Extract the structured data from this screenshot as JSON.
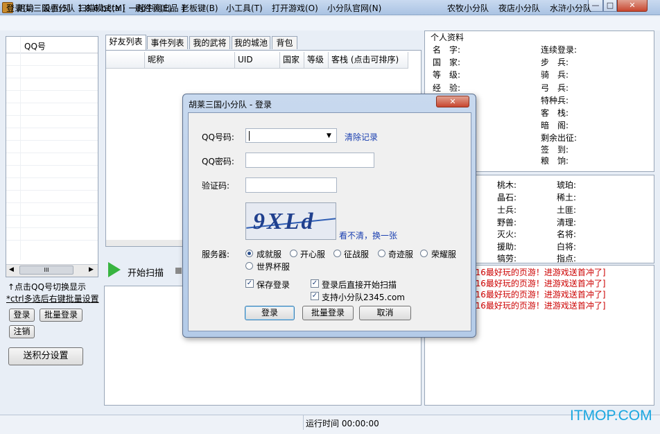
{
  "window": {
    "title": "胡莱三国小分队 1.8.6 beta [ 一起牛网出品 ]",
    "min_glyph": "—",
    "max_glyph": "□",
    "close_glyph": "✕"
  },
  "menu": {
    "left": [
      "登录(L)",
      "设置(S)",
      "扫描模式(M)",
      "刷经验(E)",
      "老板键(B)",
      "小工具(T)",
      "打开游戏(O)",
      "小分队官网(N)"
    ],
    "right": [
      "农牧小分队",
      "夜店小分队",
      "水浒小分队"
    ]
  },
  "qq_list": {
    "header": "QQ号",
    "scroll_mark": "III"
  },
  "left_panel": {
    "hint1": "↑点击QQ号切换显示",
    "hint2": "*ctrl多选后右键批量设置",
    "login_btn": "登录",
    "batch_login_btn": "批量登录",
    "logout_btn": "注销",
    "points_btn": "送积分设置"
  },
  "tabs": [
    "好友列表",
    "事件列表",
    "我的武将",
    "我的城池",
    "背包"
  ],
  "friend_table": {
    "columns": [
      "",
      "昵称",
      "UID",
      "国家",
      "等级",
      "客栈 (点击可排序)"
    ]
  },
  "scan": {
    "label": "开始扫描"
  },
  "profile": {
    "title": "个人资料",
    "left": [
      "名　字:",
      "国　家:",
      "等　级:",
      "经　验:"
    ],
    "right": [
      "连续登录:",
      "步　兵:",
      "骑　兵:",
      "弓　兵:",
      "特种兵:",
      "客　栈:",
      "暗　阁:",
      "剩余出征:",
      "签　到:",
      "粮　饷:"
    ]
  },
  "resources": {
    "col1": [
      "桃木:",
      "晶石:",
      "士兵:",
      "野兽:",
      "灭火:",
      "援助:",
      "犒劳:"
    ],
    "col2": [
      "琥珀:",
      "稀土:",
      "土匪:",
      "清理:",
      "名将:",
      "白将:",
      "指点:"
    ]
  },
  "log_lines": [
    "016最好玩的页游！进游戏送首冲了]",
    "016最好玩的页游！进游戏送首冲了]",
    "016最好玩的页游！进游戏送首冲了]",
    "016最好玩的页游！进游戏送首冲了]"
  ],
  "status": {
    "runtime": "运行时间 00:00:00"
  },
  "watermark": "ITMOP.COM",
  "dialog": {
    "title": "胡莱三国小分队 - 登录",
    "close_glyph": "✕",
    "qq_label": "QQ号码:",
    "qq_value": "",
    "clear_link": "清除记录",
    "pwd_label": "QQ密码:",
    "pwd_value": "",
    "captcha_label": "验证码:",
    "captcha_value": "",
    "captcha_text": "9XLd",
    "refresh_link": "看不清，换一张",
    "server_label": "服务器:",
    "servers": [
      "成就服",
      "开心服",
      "征战服",
      "奇迹服",
      "荣耀服",
      "世界杯服"
    ],
    "selected_server": "成就服",
    "save_login": "保存登录",
    "auto_scan": "登录后直接开始扫描",
    "support": "支持小分队2345.com",
    "login_btn": "登录",
    "batch_btn": "批量登录",
    "cancel_btn": "取消"
  }
}
